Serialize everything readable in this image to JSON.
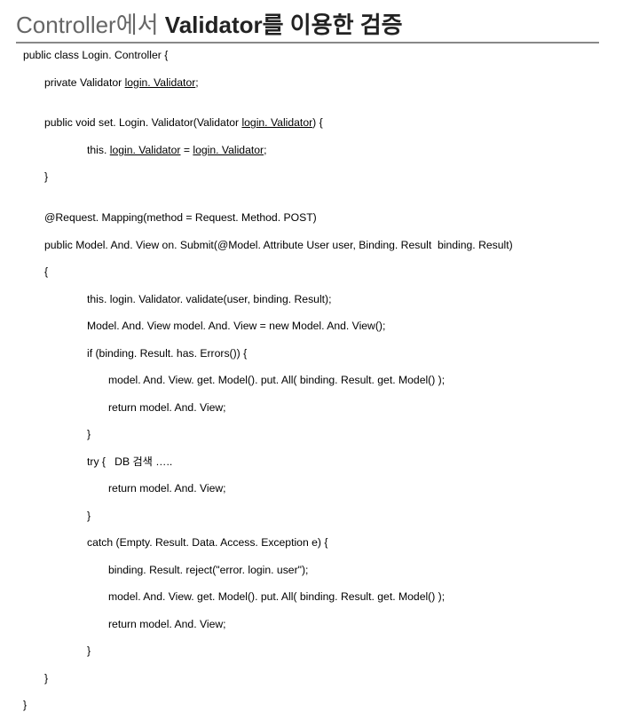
{
  "title_plain": "Controller에서 ",
  "title_bold": "Validator를 이용한 검증",
  "lines": [
    {
      "cls": "",
      "t": "public class Login. Controller {"
    },
    {
      "cls": "",
      "t": ""
    },
    {
      "cls": "ind1",
      "t": "private Validator login. Validator;",
      "u": "login. Validator"
    },
    {
      "cls": "",
      "t": ""
    },
    {
      "cls": "ind1",
      "t": "public void set. Login. Validator(Validator login. Validator) {",
      "u": "login. Validator"
    },
    {
      "cls": "ind3",
      "t": "this. login. Validator = login. Validator;",
      "u": "login. Validator"
    },
    {
      "cls": "ind1",
      "t": "}"
    },
    {
      "cls": "",
      "t": ""
    },
    {
      "cls": "ind1",
      "t": "@Request. Mapping(method = Request. Method. POST)"
    },
    {
      "cls": "ind1",
      "t": "public Model. And. View on. Submit(@Model. Attribute User user, Binding. Result  binding. Result)"
    },
    {
      "cls": "ind1",
      "t": "{"
    },
    {
      "cls": "ind3",
      "t": "this. login. Validator. validate(user, binding. Result);"
    },
    {
      "cls": "ind3",
      "t": "Model. And. View model. And. View = new Model. And. View();"
    },
    {
      "cls": "ind3",
      "t": "if (binding. Result. has. Errors()) {"
    },
    {
      "cls": "ind4",
      "t": "model. And. View. get. Model(). put. All( binding. Result. get. Model() );"
    },
    {
      "cls": "ind4",
      "t": "return model. And. View;"
    },
    {
      "cls": "ind3",
      "t": "}"
    },
    {
      "cls": "ind3",
      "t": "try {   DB 검색 ….."
    },
    {
      "cls": "ind4",
      "t": "return model. And. View;"
    },
    {
      "cls": "ind3",
      "t": "}"
    },
    {
      "cls": "ind3",
      "t": "catch (Empty. Result. Data. Access. Exception e) {"
    },
    {
      "cls": "ind4",
      "t": "binding. Result. reject(\"error. login. user\");"
    },
    {
      "cls": "ind4",
      "t": "model. And. View. get. Model(). put. All( binding. Result. get. Model() );"
    },
    {
      "cls": "ind4",
      "t": "return model. And. View;"
    },
    {
      "cls": "ind3",
      "t": "}"
    },
    {
      "cls": "ind1",
      "t": "}"
    },
    {
      "cls": "",
      "t": "}"
    }
  ]
}
